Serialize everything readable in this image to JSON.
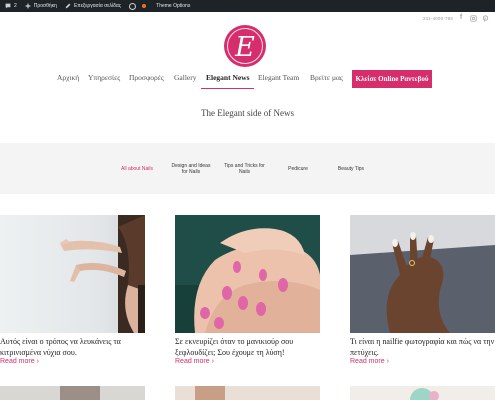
{
  "adminbar": {
    "counter": "2",
    "add_new": "Προσθήκη",
    "edit_page": "Επεξεργασία σελίδας",
    "theme_options": "Theme Options"
  },
  "header": {
    "phone": "211-4000-786",
    "logo_letter": "E"
  },
  "nav": {
    "items": [
      {
        "label": "Αρχική"
      },
      {
        "label": "Υπηρεσίες"
      },
      {
        "label": "Προσφορές"
      },
      {
        "label": "Gallery"
      },
      {
        "label": "Elegant News"
      },
      {
        "label": "Elegant Team"
      },
      {
        "label": "Βρείτε μας"
      }
    ],
    "cta": "Κλείσε Online Ραντεβού"
  },
  "tagline": "The Elegant side of News",
  "categories": [
    {
      "label": "All about Nails"
    },
    {
      "label": "Design and Ideas for Nails"
    },
    {
      "label": "Tips and Tricks for Nails"
    },
    {
      "label": "Pedicure"
    },
    {
      "label": "Beauty Tips"
    }
  ],
  "posts": [
    {
      "title": "Αυτός είναι ο τρόπος να λευκάνεις τα κιτρινισμένα νύχια σου.",
      "read_more": "Read more"
    },
    {
      "title": "Σε εκνευρίζει όταν το μανικιούρ σου ξεφλουδίζει; Σου έχουμε τη λύση!",
      "read_more": "Read more"
    },
    {
      "title": "Τι είναι η nailfie φωτογραφία και πώς να την πετύχεις.",
      "read_more": "Read more"
    }
  ],
  "colors": {
    "accent": "#d62e6c",
    "adminbar": "#1d2327",
    "category_band": "#f4f4f4"
  }
}
